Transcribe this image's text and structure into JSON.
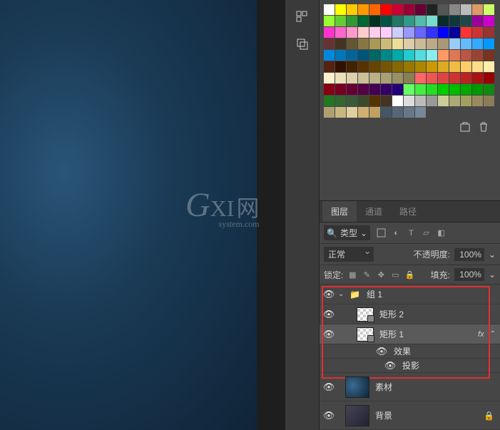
{
  "watermark": {
    "g": "G",
    "xi": "XI",
    "cn": "网",
    "domain": "system.com"
  },
  "swatches": [
    "#ffffff",
    "#ffff00",
    "#ffcc00",
    "#ff9900",
    "#ff6600",
    "#ff0000",
    "#cc0033",
    "#990033",
    "#660033",
    "#222222",
    "#555555",
    "#888888",
    "#bbbbbb",
    "#dd9966",
    "#ccff66",
    "#99ff33",
    "#66cc33",
    "#339933",
    "#006633",
    "#003322",
    "#005544",
    "#227766",
    "#339988",
    "#55bbaa",
    "#77ddcc",
    "#0b2b2b",
    "#113838",
    "#204848",
    "#990099",
    "#cc00cc",
    "#ff33cc",
    "#ff66cc",
    "#ff99cc",
    "#ffcccc",
    "#ffccee",
    "#ffccff",
    "#ccccff",
    "#9999ff",
    "#6666ff",
    "#3333ff",
    "#0000ff",
    "#000099",
    "#ff3333",
    "#cc3333",
    "#993333",
    "#663333",
    "#443322",
    "#665533",
    "#887744",
    "#aa9955",
    "#ccbb77",
    "#eedd99",
    "#ddccaa",
    "#ccbb99",
    "#bbaa88",
    "#aa9977",
    "#99ccff",
    "#66bbff",
    "#33aaff",
    "#0099ff",
    "#0088dd",
    "#0077bb",
    "#006699",
    "#005577",
    "#006666",
    "#008888",
    "#00aaaa",
    "#22cccc",
    "#55dddd",
    "#88eeee",
    "#ff9966",
    "#dd7755",
    "#bb5544",
    "#994433",
    "#773322",
    "#552211",
    "#331100",
    "#442200",
    "#553300",
    "#664400",
    "#775500",
    "#886600",
    "#997700",
    "#aa8800",
    "#cc9900",
    "#ddaa22",
    "#eebb44",
    "#ffcc66",
    "#ffdd88",
    "#ffeeaa",
    "#fff0cc",
    "#eee0bb",
    "#ddd0aa",
    "#ccc099",
    "#bbb088",
    "#aaa077",
    "#999066",
    "#888055",
    "#ff6666",
    "#ee5555",
    "#dd4444",
    "#cc3333",
    "#bb2222",
    "#aa1111",
    "#990000",
    "#880011",
    "#770022",
    "#660033",
    "#550044",
    "#440055",
    "#330066",
    "#220077",
    "#66ff66",
    "#44ee44",
    "#22dd22",
    "#00cc00",
    "#00bb00",
    "#00aa00",
    "#009900",
    "#118811",
    "#227722",
    "#336633",
    "#3a5a3a",
    "#3a4a2a",
    "#553300",
    "#443322",
    "#ffffff",
    "#dddddd",
    "#bbbbbb",
    "#999999",
    "#cccc99",
    "#aaaa77",
    "#a0a060",
    "#9a8a60",
    "#8c7c58",
    "#b0a070",
    "#c8b880",
    "#e0d0a0",
    "#d0b070",
    "#c0a060",
    "#445566",
    "#556677",
    "#667788",
    "#778899"
  ],
  "panels": {
    "tabs": {
      "layers": "图层",
      "channels": "通道",
      "paths": "路径"
    },
    "filter": {
      "kind_label": "类型"
    },
    "blend": {
      "mode": "正常",
      "opacity_label": "不透明度:",
      "opacity_value": "100%"
    },
    "lock": {
      "label": "锁定:",
      "fill_label": "填充:",
      "fill_value": "100%"
    }
  },
  "layers": {
    "group1": "组 1",
    "rect2": "矩形 2",
    "rect1": "矩形 1",
    "fx": "fx",
    "effects": "效果",
    "drop_shadow": "投影",
    "material": "素材",
    "background": "背景"
  }
}
